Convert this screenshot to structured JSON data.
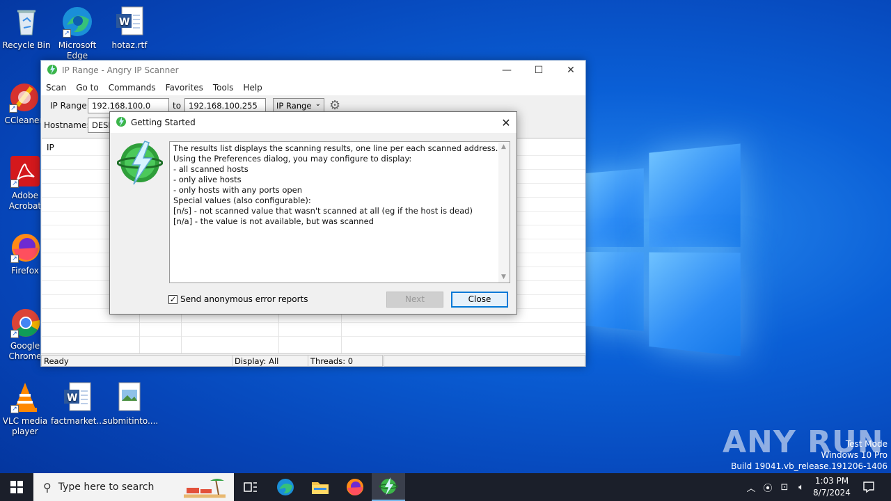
{
  "desktop": {
    "icons": [
      {
        "label": "Recycle Bin"
      },
      {
        "label": "Microsoft Edge"
      },
      {
        "label": "hotaz.rtf"
      },
      {
        "label": "CCleaner"
      },
      {
        "label": "Adobe Acrobat"
      },
      {
        "label": "Firefox"
      },
      {
        "label": "Google Chrome"
      },
      {
        "label": "VLC media player"
      },
      {
        "label": "factmarket..."
      },
      {
        "label": "submitinto...."
      }
    ]
  },
  "main_window": {
    "title": "IP Range - Angry IP Scanner",
    "menu": [
      "Scan",
      "Go to",
      "Commands",
      "Favorites",
      "Tools",
      "Help"
    ],
    "ip_range_label": "IP Range:",
    "ip_from": "192.168.100.0",
    "to_label": "to",
    "ip_to": "192.168.100.255",
    "range_type": "IP Range",
    "hostname_label": "Hostname:",
    "hostname_value": "DESK",
    "column_ip": "IP",
    "status": {
      "ready": "Ready",
      "display": "Display: All",
      "threads": "Threads: 0"
    }
  },
  "dialog": {
    "title": "Getting Started",
    "lines": [
      "The results list displays the scanning results, one line per each scanned address.",
      "",
      "Using the Preferences dialog, you may configure to display:",
      "- all scanned hosts",
      "- only alive hosts",
      "- only hosts with any ports open",
      "",
      "Special values (also configurable):",
      "[n/s] - not scanned value that wasn't scanned at all (eg if the host is dead)",
      "[n/a] - the value is not available, but was scanned"
    ],
    "checkbox_label": "Send anonymous error reports",
    "checkbox_checked": true,
    "next_label": "Next",
    "close_label": "Close"
  },
  "taskbar": {
    "search_placeholder": "Type here to search",
    "time": "1:03 PM",
    "date": "8/7/2024"
  },
  "overlay": {
    "watermark": "ANY RUN",
    "test_mode": "Test Mode",
    "edition": "Windows 10 Pro",
    "build": "Build 19041.vb_release.191206-1406"
  }
}
